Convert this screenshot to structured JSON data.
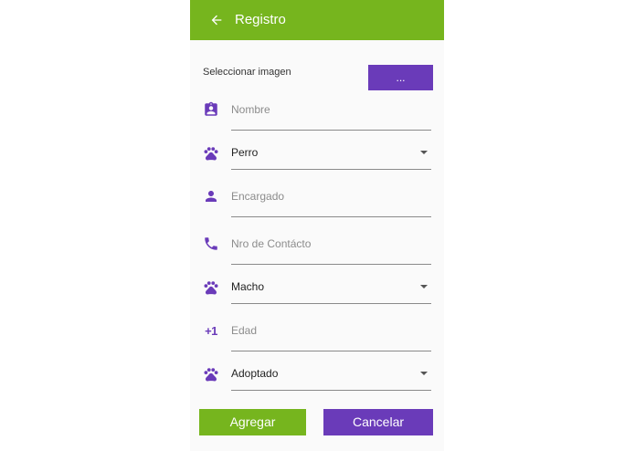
{
  "app": {
    "title": "Registro",
    "colors": {
      "primary": "#76b51e",
      "accent": "#6a3bb9"
    }
  },
  "image_picker": {
    "label": "Seleccionar imagen",
    "button_label": "..."
  },
  "form": {
    "fields": [
      {
        "id": "nombre",
        "icon": "id-badge-icon",
        "type": "text",
        "placeholder": "Nombre",
        "value": ""
      },
      {
        "id": "especie",
        "icon": "paw-icon",
        "type": "dropdown",
        "value": "Perro"
      },
      {
        "id": "encargado",
        "icon": "person-icon",
        "type": "text",
        "placeholder": "Encargado",
        "value": ""
      },
      {
        "id": "contacto",
        "icon": "phone-icon",
        "type": "text",
        "placeholder": "Nro de Contácto",
        "value": ""
      },
      {
        "id": "sexo",
        "icon": "paw-icon",
        "type": "dropdown",
        "value": "Macho"
      },
      {
        "id": "edad",
        "icon": "plus-one-icon",
        "icon_text": "+1",
        "type": "text",
        "placeholder": "Edad",
        "value": ""
      },
      {
        "id": "estado",
        "icon": "paw-icon",
        "type": "dropdown",
        "value": "Adoptado"
      }
    ]
  },
  "actions": {
    "add_label": "Agregar",
    "cancel_label": "Cancelar"
  }
}
